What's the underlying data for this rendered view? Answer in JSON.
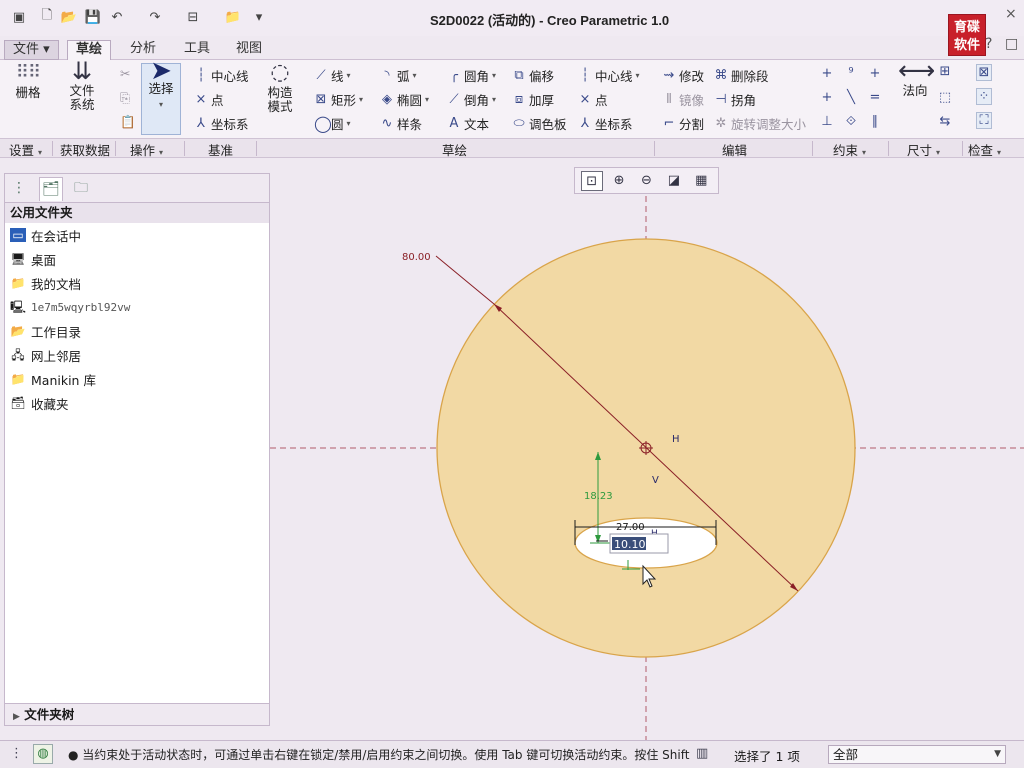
{
  "window": {
    "title": "S2D0022 (活动的) - Creo Parametric 1.0",
    "logo_text": [
      "育碟",
      "软件"
    ],
    "controls": [
      "–",
      "□",
      "×",
      "?"
    ]
  },
  "menu_tabs": [
    "文件 ▾",
    "草绘",
    "分析",
    "工具",
    "视图"
  ],
  "ribbon": {
    "setup": {
      "grid": "栅格"
    },
    "getdata": {
      "filesystem_line1": "文件",
      "filesystem_line2": "系统"
    },
    "operations": {
      "select": "选择"
    },
    "datum": {
      "centerline": "中心线",
      "point": "点",
      "coordsys": "坐标系"
    },
    "construct": {
      "line1": "构造",
      "line2": "模式"
    },
    "sketch": {
      "line": "线",
      "arc": "弧",
      "fillet": "圆角",
      "offset": "偏移",
      "rectangle": "矩形",
      "ellipse": "椭圆",
      "chamfer": "倒角",
      "thicken": "加厚",
      "circle": "圆",
      "spline": "样条",
      "text": "文本",
      "palette": "调色板",
      "centerline": "中心线",
      "point": "点",
      "coordsys": "坐标系"
    },
    "edit": {
      "modify": "修改",
      "delete_segment": "删除段",
      "mirror": "镜像",
      "corner": "拐角",
      "divide": "分割",
      "rotate_resize": "旋转调整大小"
    },
    "dimension": {
      "normal": "法向"
    },
    "groups": {
      "setup": "设置",
      "getdata": "获取数据",
      "operations": "操作",
      "datum": "基准",
      "sketch": "草绘",
      "edit": "编辑",
      "constrain": "约束",
      "dimension": "尺寸",
      "inspect": "检查"
    }
  },
  "folder_panel": {
    "header": "公用文件夹",
    "items": [
      {
        "label": "在会话中",
        "icon": "monitor-icon"
      },
      {
        "label": "桌面",
        "icon": "desktop-icon"
      },
      {
        "label": "我的文档",
        "icon": "documents-icon"
      },
      {
        "label": "1e7m5wqyrbl92vw",
        "icon": "computer-icon"
      },
      {
        "label": "工作目录",
        "icon": "folder-icon"
      },
      {
        "label": "网上邻居",
        "icon": "network-icon"
      },
      {
        "label": "Manikin 库",
        "icon": "library-icon"
      },
      {
        "label": "收藏夹",
        "icon": "favorites-icon"
      }
    ],
    "tree": "文件夹树"
  },
  "sketch": {
    "diameter_dim": "80.00",
    "vertical_dim": "18.23",
    "ellipse_width_dim": "27.00",
    "edit_value": "10.10",
    "h_label": "H",
    "v_label": "V",
    "colors": {
      "fill": "#f2d9a4",
      "edge": "#d9a44a",
      "dim": "#8a1f26",
      "dim_green": "#2e9a3e"
    }
  },
  "status": {
    "message": "● 当约束处于活动状态时，可通过单击右键在锁定/禁用/启用约束之间切换。使用 Tab 键可切换活动约束。按住 Shift",
    "selected": "选择了 1 项",
    "filter": "全部"
  }
}
